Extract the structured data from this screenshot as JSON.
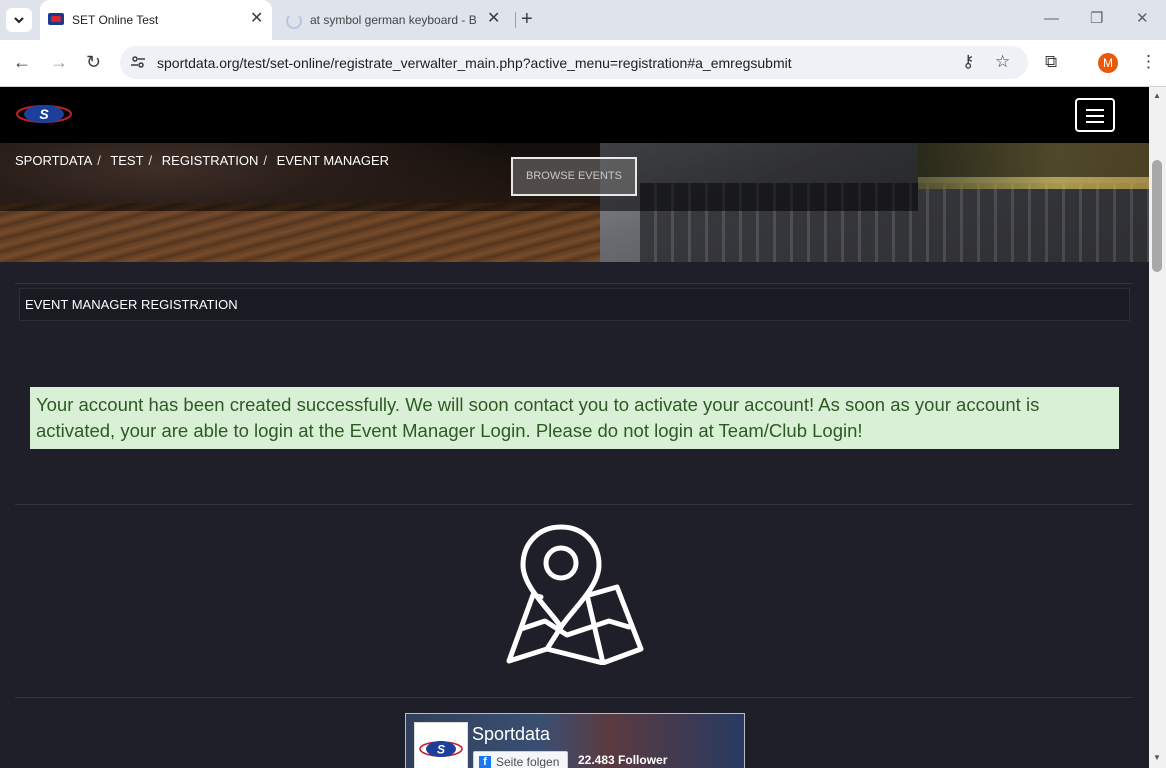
{
  "browser": {
    "tabs": [
      {
        "title": "SET Online Test",
        "active": true
      },
      {
        "title": "at symbol german keyboard - B",
        "active": false,
        "loading": true
      }
    ],
    "url": "sportdata.org/test/set-online/registrate_verwalter_main.php?active_menu=registration#a_emregsubmit",
    "profile_initial": "M"
  },
  "icons": {
    "tab_search": "chevron-down-icon",
    "close": "close-icon",
    "new_tab": "plus-icon",
    "back": "arrow-left-icon",
    "forward": "arrow-right-icon",
    "reload": "reload-icon",
    "site_info": "tune-icon",
    "password": "key-icon",
    "bookmark": "star-icon",
    "extensions": "puzzle-icon",
    "menu": "kebab-menu-icon",
    "map": "map-pin-icon"
  },
  "breadcrumb": [
    "SPORTDATA",
    "TEST",
    "REGISTRATION",
    "EVENT MANAGER"
  ],
  "hero": {
    "button": "BROWSE EVENTS"
  },
  "section": {
    "title": "EVENT MANAGER REGISTRATION"
  },
  "alert": {
    "message": "Your account has been created successfully. We will soon contact you to activate your account! As soon as your account is activated, your are able to login at the Event Manager Login. Please do not login at Team/Club Login!",
    "background": "#d9f0d6",
    "text_color": "#2d5a24"
  },
  "facebook": {
    "page_name": "Sportdata",
    "follow_label": "Seite folgen",
    "followers": "22.483 Follower"
  }
}
